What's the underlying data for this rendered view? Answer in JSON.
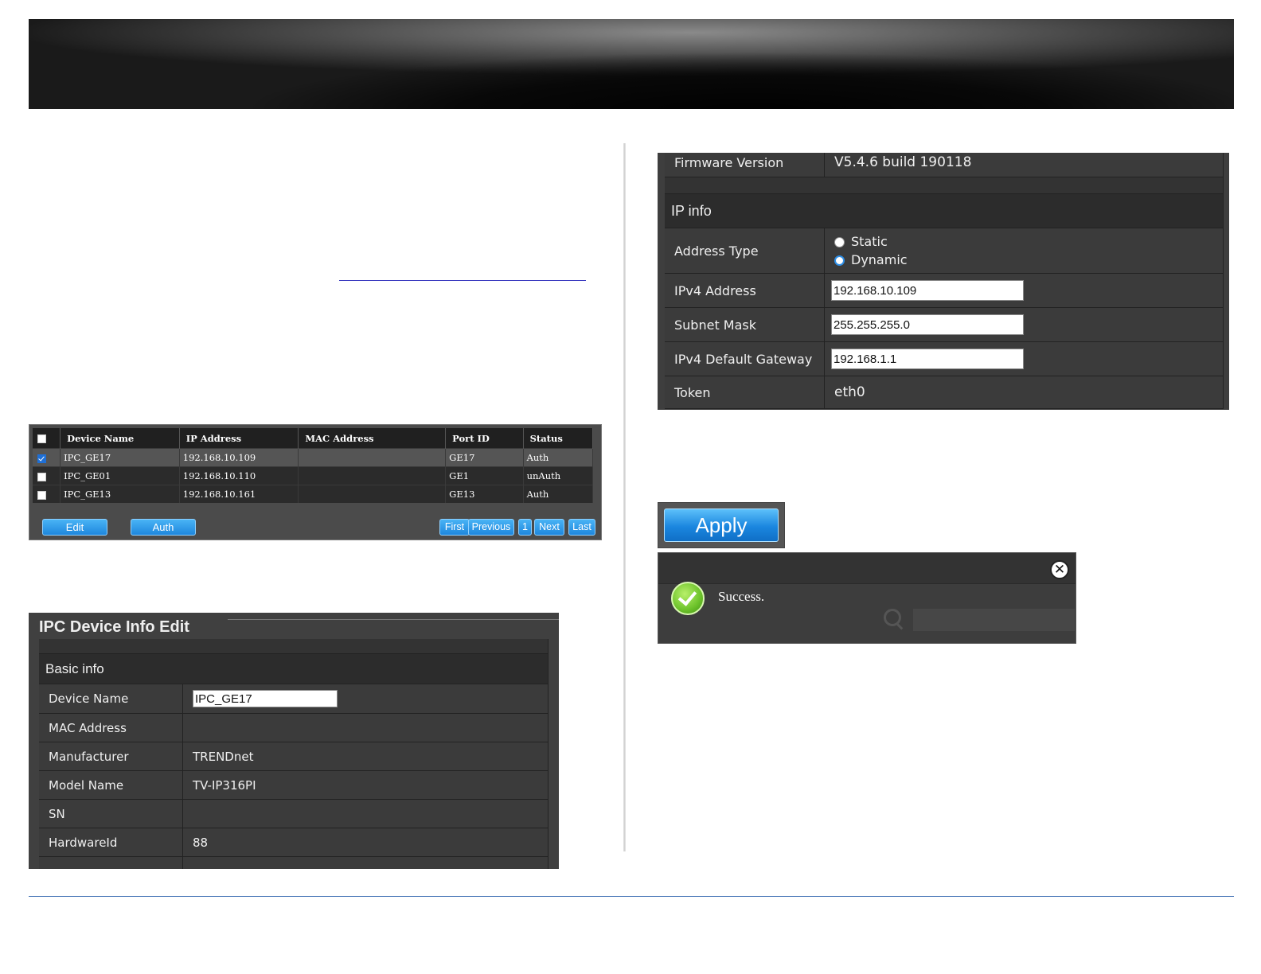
{
  "device_list": {
    "columns": [
      "",
      "Device Name",
      "IP Address",
      "MAC Address",
      "Port ID",
      "Status"
    ],
    "rows": [
      {
        "checked": true,
        "device_name": "IPC_GE17",
        "ip": "192.168.10.109",
        "mac": "",
        "port": "GE17",
        "status": "Auth"
      },
      {
        "checked": false,
        "device_name": "IPC_GE01",
        "ip": "192.168.10.110",
        "mac": "",
        "port": "GE1",
        "status": "unAuth"
      },
      {
        "checked": false,
        "device_name": "IPC_GE13",
        "ip": "192.168.10.161",
        "mac": "",
        "port": "GE13",
        "status": "Auth"
      }
    ],
    "edit_label": "Edit",
    "auth_label": "Auth",
    "pager": {
      "first": "First",
      "previous": "Previous",
      "page": "1",
      "next": "Next",
      "last": "Last"
    }
  },
  "ipc_edit": {
    "title": "IPC Device Info Edit",
    "section": "Basic info",
    "fields": [
      {
        "label": "Device Name",
        "value": "IPC_GE17"
      },
      {
        "label": "MAC Address",
        "value": ""
      },
      {
        "label": "Manufacturer",
        "value": "TRENDnet"
      },
      {
        "label": "Model Name",
        "value": "TV-IP316PI"
      },
      {
        "label": "SN",
        "value": ""
      },
      {
        "label": "HardwareId",
        "value": "88"
      }
    ]
  },
  "info_panel": {
    "firmware_label": "Firmware Version",
    "firmware_value": "V5.4.6 build 190118",
    "section": "IP info",
    "address_type_label": "Address Type",
    "address_type_options": [
      "Static",
      "Dynamic"
    ],
    "address_type_selected": "Dynamic",
    "ipv4_label": "IPv4 Address",
    "ipv4_value": "192.168.10.109",
    "mask_label": "Subnet Mask",
    "mask_value": "255.255.255.0",
    "gateway_label": "IPv4 Default Gateway",
    "gateway_value": "192.168.1.1",
    "token_label": "Token",
    "token_value": "eth0"
  },
  "apply_label": "Apply",
  "success": {
    "message": "Success."
  },
  "colors": {
    "accent_blue": "#1e87dd",
    "success_green": "#6cc22a",
    "panel_dark": "#3e3e3e"
  }
}
